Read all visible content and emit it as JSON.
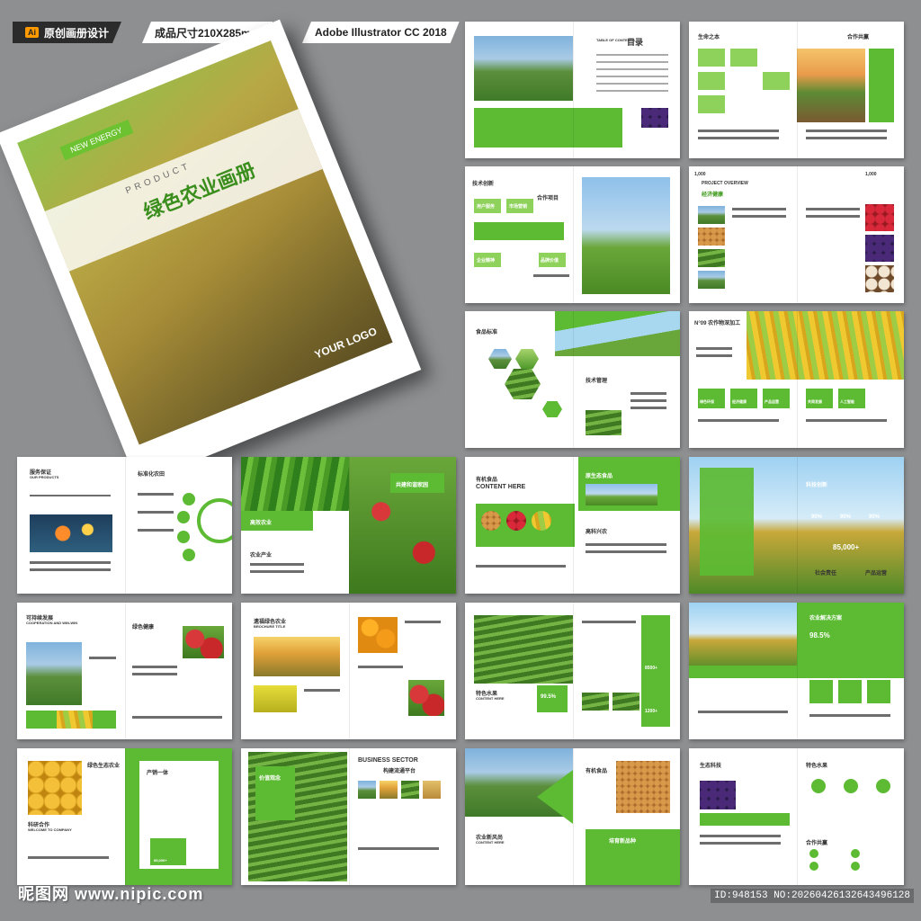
{
  "header": {
    "tag1": "原创画册设计",
    "tag1_badge": "Ai",
    "tag2": "成品尺寸210X285mm",
    "tag3": "Adobe Illustrator CC 2018"
  },
  "cover": {
    "tag": "NEW ENERGY",
    "product": "PRODUCT",
    "title": "绿色农业画册",
    "logo": "YOUR LOGO"
  },
  "spreads": {
    "s1": {
      "toc_en": "TABLE OF CONTENTS",
      "toc": "目录"
    },
    "s2": {
      "title": "生命之本",
      "right": "合作共赢"
    },
    "s3": {
      "title": "技术创新",
      "mid": "合作项目",
      "b1": "用户服务",
      "b2": "市场营销",
      "b3": "企业精神",
      "b4": "品牌价值"
    },
    "s4": {
      "overview": "PROJECT OVERVIEW",
      "sub": "经济健康",
      "num": "1,000"
    },
    "s5": {
      "title": "食品标准",
      "mid": "技术管理"
    },
    "s6": {
      "title": "N°09 农作物深加工",
      "items": [
        "绿色环保",
        "经济健康",
        "产品运营",
        "共同发展",
        "人工智能"
      ]
    },
    "s7": {
      "title": "服务保证",
      "sub": "OUR PRODUCTS",
      "right": "标准化农田"
    },
    "s8": {
      "a": "高效农业",
      "b": "农业产业",
      "c": "共建和谐家园"
    },
    "s9": {
      "title": "有机食品",
      "en": "CONTENT HERE",
      "right": "原生态食品",
      "r2": "高科兴农"
    },
    "s10": {
      "title": "科技创新",
      "stat1": "90%",
      "stat2": "90%",
      "stat3": "90%",
      "big": "85,000+",
      "l1": "社会责任",
      "l2": "产品运营"
    },
    "s11": {
      "title": "可持续发展",
      "sub": "COOPERATION AND WIN-WIN",
      "right": "绿色健康"
    },
    "s12": {
      "title": "遗福绿色农业",
      "sub": "BROCHURE TITLE"
    },
    "s13": {
      "title": "特色水果",
      "en": "CONTENT HERE",
      "pct": "99.5%",
      "r1": "8500+",
      "r2": "1200+"
    },
    "s14": {
      "title": "农业解决方案",
      "pct": "98.5%"
    },
    "s15": {
      "title": "绿色生态农业",
      "sub": "科研合作",
      "en": "WELCOME TO COMPANY",
      "r": "产销一体",
      "num": "85,000+"
    },
    "s16": {
      "title": "价值观念",
      "en": "BUSINESS SECTOR",
      "r": "构建流通平台"
    },
    "s17": {
      "title": "有机食品",
      "l": "农业新风尚",
      "en": "CONTENT HERE",
      "r": "培育新品种"
    },
    "s18": {
      "title": "生态科技",
      "r": "特色水果",
      "r2": "合作共赢"
    }
  },
  "watermark": {
    "brand": "昵图网 www.nipic.com",
    "id": "ID:948153 NO:20260426132643496128"
  }
}
